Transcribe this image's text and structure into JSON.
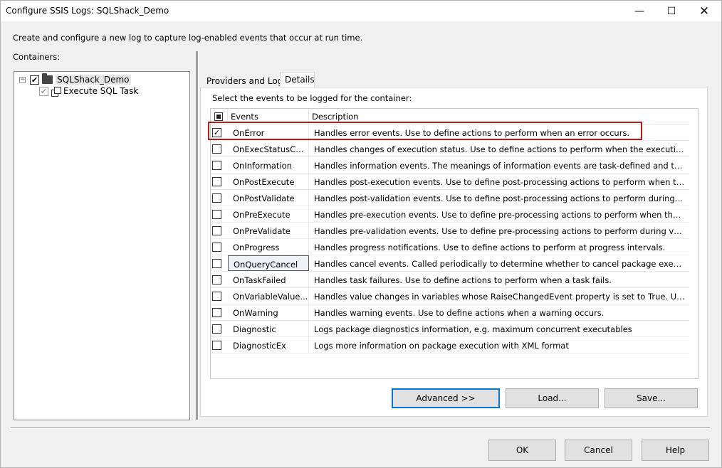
{
  "window": {
    "title": "Configure SSIS Logs: SQLShack_Demo",
    "minimize_glyph": "—",
    "maximize_glyph": "☐",
    "close_glyph": "✕"
  },
  "intro_text": "Create and configure a new log to capture log-enabled events that occur at run time.",
  "containers_label": "Containers:",
  "tree": {
    "root": {
      "label": "SQLShack_Demo",
      "checked": true,
      "expanded": true,
      "expander_glyph": "−"
    },
    "children": [
      {
        "label": "Execute SQL Task",
        "checked": true,
        "inherited": true
      }
    ]
  },
  "tabs": [
    {
      "label": "Providers and Logs",
      "active": false
    },
    {
      "label": "Details",
      "active": true
    }
  ],
  "details": {
    "instruction": "Select the events to be logged for the container:",
    "columns": {
      "events": "Events",
      "description": "Description"
    },
    "rows": [
      {
        "event": "OnError",
        "description": "Handles error events. Use to define actions to perform when an error occurs.",
        "checked": true
      },
      {
        "event": "OnExecStatusCh...",
        "description": "Handles changes of execution status. Use to define actions to perform when the execution status...",
        "checked": false
      },
      {
        "event": "OnInformation",
        "description": "Handles information events. The meanings of information events are task-defined and task-spec...",
        "checked": false
      },
      {
        "event": "OnPostExecute",
        "description": "Handles post-execution events. Use to define post-processing actions to perform when the pack...",
        "checked": false
      },
      {
        "event": "OnPostValidate",
        "description": "Handles post-validation events. Use to define post-processing actions to perform during validati...",
        "checked": false
      },
      {
        "event": "OnPreExecute",
        "description": "Handles pre-execution events. Use to define pre-processing actions to perform when the packag...",
        "checked": false
      },
      {
        "event": "OnPreValidate",
        "description": "Handles pre-validation events. Use to define pre-processing actions to perform during validation",
        "checked": false
      },
      {
        "event": "OnProgress",
        "description": "Handles progress notifications. Use to define actions to perform at progress intervals.",
        "checked": false
      },
      {
        "event": "OnQueryCancel",
        "description": "Handles cancel events. Called periodically to determine whether to cancel package execution.",
        "checked": false
      },
      {
        "event": "OnTaskFailed",
        "description": "Handles task failures. Use to define actions to perform when a task fails.",
        "checked": false
      },
      {
        "event": "OnVariableValue...",
        "description": "Handles value changes in variables whose RaiseChangedEvent property is set to True. Use to defi...",
        "checked": false
      },
      {
        "event": "OnWarning",
        "description": "Handles warning events. Use to define actions when a warning occurs.",
        "checked": false
      },
      {
        "event": "Diagnostic",
        "description": "Logs package diagnostics information, e.g. maximum concurrent executables",
        "checked": false
      },
      {
        "event": "DiagnosticEx",
        "description": "Logs more information on package execution with XML format",
        "checked": false
      }
    ],
    "buttons": {
      "advanced": "Advanced >>",
      "load": "Load...",
      "save": "Save..."
    }
  },
  "footer_buttons": {
    "ok": "OK",
    "cancel": "Cancel",
    "help": "Help"
  },
  "colors": {
    "highlight_border": "#b71c1c",
    "default_button_border": "#0078d7"
  }
}
